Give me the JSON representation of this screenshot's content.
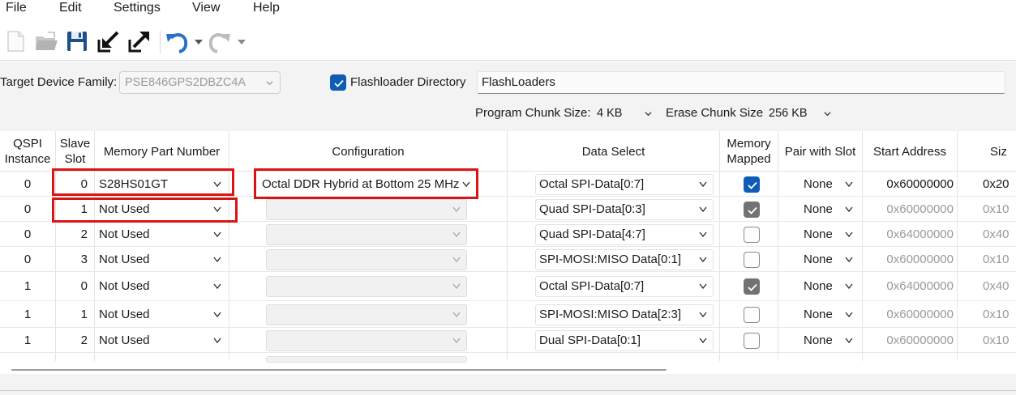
{
  "menu": [
    "File",
    "Edit",
    "Settings",
    "View",
    "Help"
  ],
  "toolbar": {
    "icons": [
      "new-file-icon",
      "open-folder-icon",
      "save-icon",
      "import-icon",
      "export-icon",
      "undo-icon",
      "undo-dropdown-icon",
      "redo-icon",
      "redo-dropdown-icon"
    ]
  },
  "settings": {
    "target_device_family_label": "Target Device Family:",
    "target_device_family_value": "PSE846GPS2DBZC4A",
    "flashloader_checked": true,
    "flashloader_label": "Flashloader Directory",
    "flashloader_value": "FlashLoaders",
    "program_chunk_label": "Program Chunk Size:",
    "program_chunk_value": "4 KB",
    "erase_chunk_label": "Erase Chunk Size:",
    "erase_chunk_value": "256 KB"
  },
  "table": {
    "headers": {
      "qspi": [
        "QSPI",
        "Instance"
      ],
      "slave": [
        "Slave",
        "Slot"
      ],
      "part": "Memory Part Number",
      "config": "Configuration",
      "data_select": "Data Select",
      "mapped": [
        "Memory",
        "Mapped"
      ],
      "pair": "Pair with Slot",
      "start": "Start Address",
      "size": "Siz"
    },
    "rows": [
      {
        "qspi": "0",
        "slot": "0",
        "part": "S28HS01GT",
        "config": "Octal DDR Hybrid at Bottom 25 MHz",
        "data": "Octal SPI-Data[0:7]",
        "mapped": "checked",
        "pair": "None",
        "start": "0x60000000",
        "size": "0x20"
      },
      {
        "qspi": "0",
        "slot": "1",
        "part": "Not Used",
        "config": "",
        "data": "Quad SPI-Data[0:3]",
        "mapped": "grey",
        "pair": "None",
        "start": "0x60000000",
        "size": "0x10"
      },
      {
        "qspi": "0",
        "slot": "2",
        "part": "Not Used",
        "config": "",
        "data": "Quad SPI-Data[4:7]",
        "mapped": "off",
        "pair": "None",
        "start": "0x64000000",
        "size": "0x40"
      },
      {
        "qspi": "0",
        "slot": "3",
        "part": "Not Used",
        "config": "",
        "data": "SPI-MOSI:MISO Data[0:1]",
        "mapped": "off",
        "pair": "None",
        "start": "0x60000000",
        "size": "0x10"
      },
      {
        "qspi": "1",
        "slot": "0",
        "part": "Not Used",
        "config": "",
        "data": "Octal SPI-Data[0:7]",
        "mapped": "grey",
        "pair": "None",
        "start": "0x64000000",
        "size": "0x40"
      },
      {
        "qspi": "1",
        "slot": "1",
        "part": "Not Used",
        "config": "",
        "data": "SPI-MOSI:MISO Data[2:3]",
        "mapped": "off",
        "pair": "None",
        "start": "0x60000000",
        "size": "0x10"
      },
      {
        "qspi": "1",
        "slot": "2",
        "part": "Not Used",
        "config": "",
        "data": "Dual SPI-Data[0:1]",
        "mapped": "off",
        "pair": "None",
        "start": "0x60000000",
        "size": "0x10"
      }
    ]
  },
  "colors": {
    "highlight": "#d81414",
    "check_blue": "#0f5cb5",
    "check_grey": "#727272",
    "panel_bg": "#f3f3f3"
  }
}
